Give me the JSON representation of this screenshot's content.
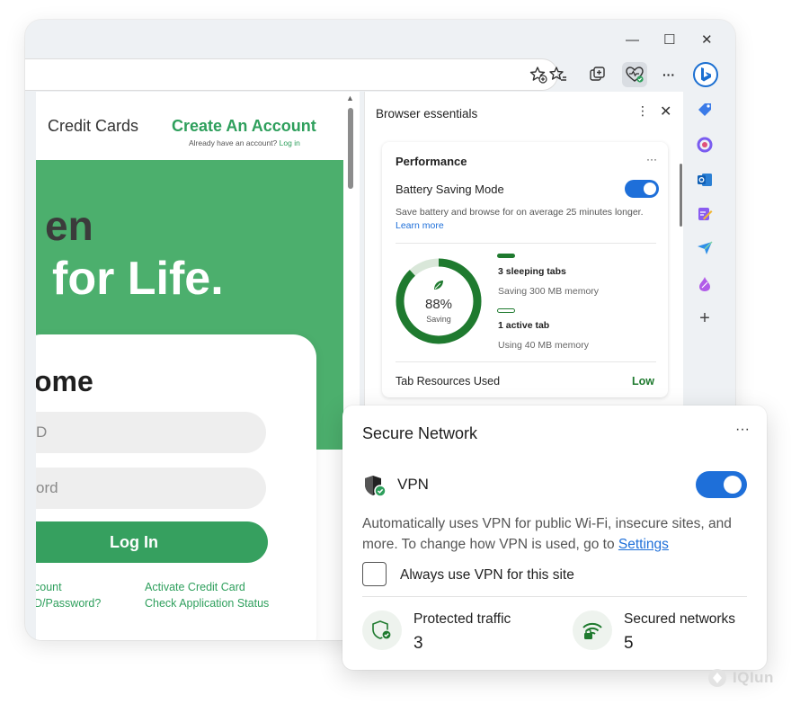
{
  "browser": {
    "window_controls": {
      "minimize": "—",
      "maximize": "☐",
      "close": "✕"
    },
    "more_label": "···"
  },
  "website": {
    "nav": {
      "credit_cards": "Credit Cards",
      "create_account": "Create An Account",
      "login_prompt": "Already have an account?",
      "login_link": "Log in"
    },
    "hero": {
      "line1": "en",
      "line2": "for Life."
    },
    "login": {
      "welcome": "ome",
      "user_field": "D",
      "password_field": "ord",
      "login_button": "Log In",
      "links": {
        "account": "count",
        "forgot": "D/Password?",
        "activate": "Activate Credit Card",
        "status": "Check Application Status"
      }
    }
  },
  "essentials": {
    "title": "Browser essentials",
    "kebab": "⋮",
    "close": "✕",
    "performance": {
      "title": "Performance",
      "more": "···",
      "battery_label": "Battery Saving Mode",
      "battery_on": true,
      "battery_desc": "Save battery and browse for on average 25 minutes longer.",
      "learn_more": "Learn more",
      "saving_percent": "88%",
      "saving_value": 0.88,
      "saving_label": "Saving",
      "sleeping_tabs": "3 sleeping tabs",
      "sleeping_memory": "Saving 300 MB memory",
      "active_tabs": "1 active tab",
      "active_memory": "Using 40 MB memory",
      "resources_label": "Tab Resources Used",
      "resources_level": "Low"
    }
  },
  "secure_network": {
    "title": "Secure Network",
    "more": "···",
    "vpn_label": "VPN",
    "vpn_on": true,
    "description": "Automatically uses VPN for public Wi-Fi, insecure sites, and more. To change how VPN is used, go to",
    "settings_link": "Settings",
    "always_use_label": "Always use VPN for this site",
    "protected_label": "Protected traffic",
    "protected_value": "3",
    "secured_label": "Secured networks",
    "secured_value": "5"
  },
  "watermark": "IQIun",
  "colors": {
    "accent_blue": "#1e6fd9",
    "brand_green": "#4caf6d",
    "perf_green": "#1f7a2f"
  }
}
